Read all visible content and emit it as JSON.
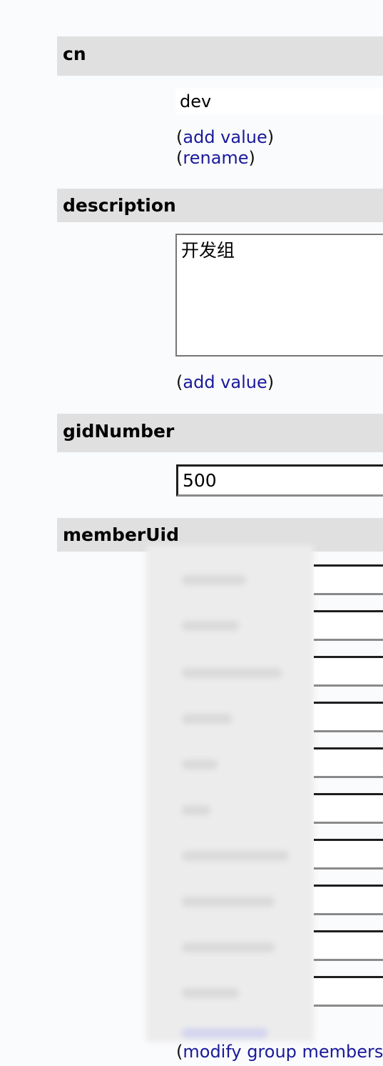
{
  "cn": {
    "label": "cn",
    "value": "dev",
    "add_value_link": "add value",
    "rename_link": "rename"
  },
  "description": {
    "label": "description",
    "value": "开发组",
    "add_value_link": "add value"
  },
  "gidNumber": {
    "label": "gidNumber",
    "value": "500"
  },
  "memberUid": {
    "label": "memberUid",
    "modify_link": "modify group members"
  }
}
